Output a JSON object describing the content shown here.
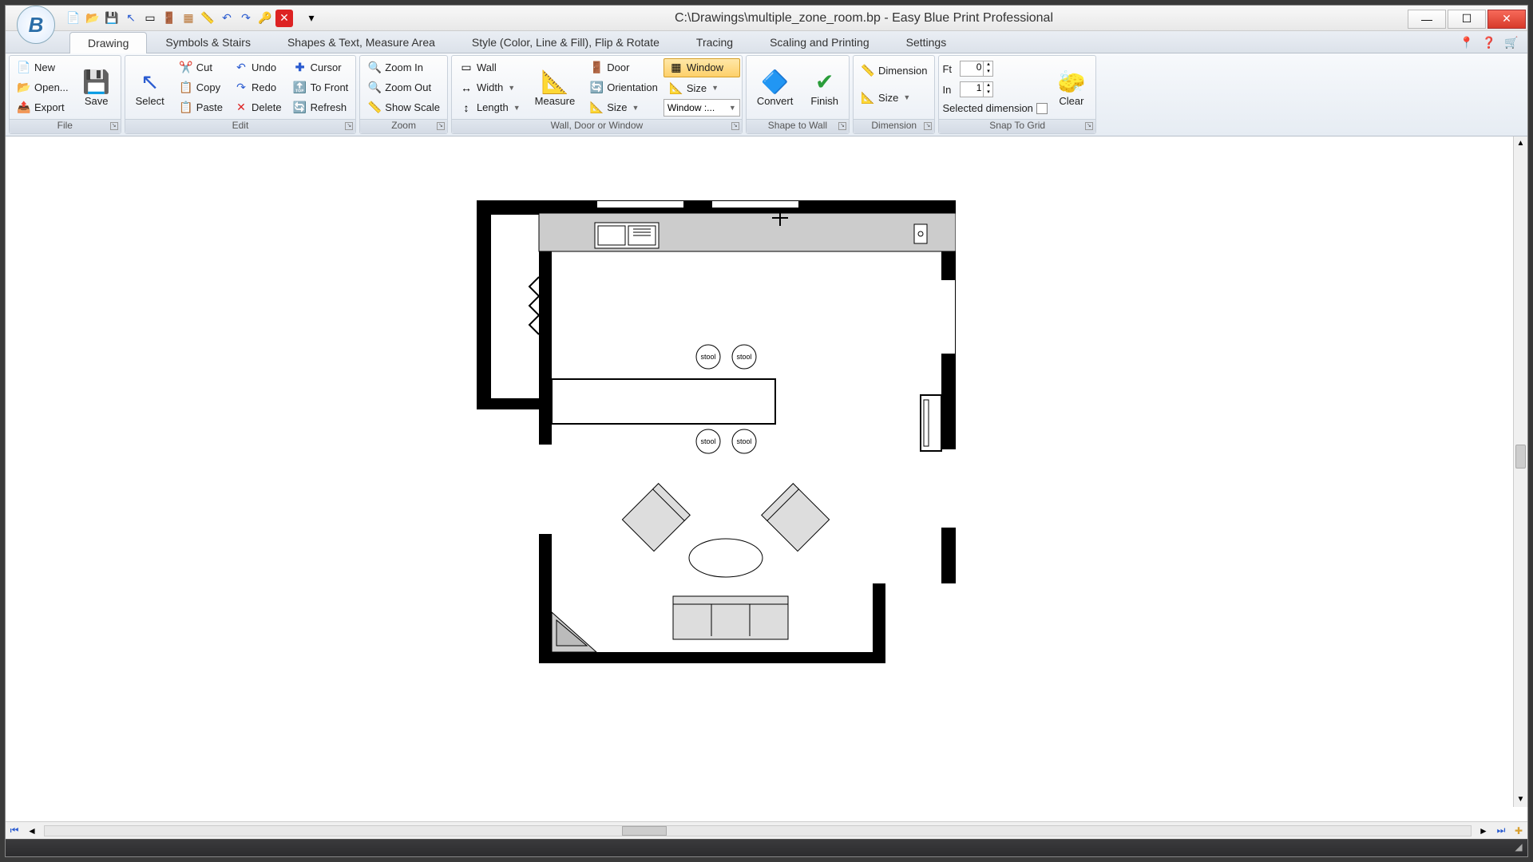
{
  "title": "C:\\Drawings\\multiple_zone_room.bp - Easy Blue Print Professional",
  "tabs": {
    "drawing": "Drawing",
    "symbols": "Symbols & Stairs",
    "shapes": "Shapes & Text, Measure Area",
    "style": "Style (Color, Line & Fill), Flip & Rotate",
    "tracing": "Tracing",
    "scaling": "Scaling and Printing",
    "settings": "Settings"
  },
  "ribbon": {
    "file": {
      "new": "New",
      "open": "Open...",
      "export": "Export",
      "save": "Save",
      "group": "File"
    },
    "edit": {
      "select": "Select",
      "cut": "Cut",
      "copy": "Copy",
      "paste": "Paste",
      "undo": "Undo",
      "redo": "Redo",
      "delete": "Delete",
      "cursor": "Cursor",
      "tofront": "To Front",
      "refresh": "Refresh",
      "group": "Edit"
    },
    "zoom": {
      "zoomin": "Zoom In",
      "zoomout": "Zoom Out",
      "showscale": "Show Scale",
      "group": "Zoom"
    },
    "wdw": {
      "wall": "Wall",
      "width": "Width",
      "length": "Length",
      "measure": "Measure",
      "door": "Door",
      "orientation": "Orientation",
      "size": "Size",
      "window": "Window",
      "size2": "Size",
      "windowcombo": "Window :...",
      "group": "Wall, Door or Window"
    },
    "shape": {
      "convert": "Convert",
      "finish": "Finish",
      "group": "Shape to Wall"
    },
    "dim": {
      "dimension": "Dimension",
      "size": "Size",
      "group": "Dimension"
    },
    "snap": {
      "ft": "Ft",
      "in": "In",
      "ftval": "0",
      "inval": "1",
      "seldim": "Selected dimension",
      "clear": "Clear",
      "group": "Snap To Grid"
    }
  },
  "plan": {
    "stool": "stool"
  }
}
